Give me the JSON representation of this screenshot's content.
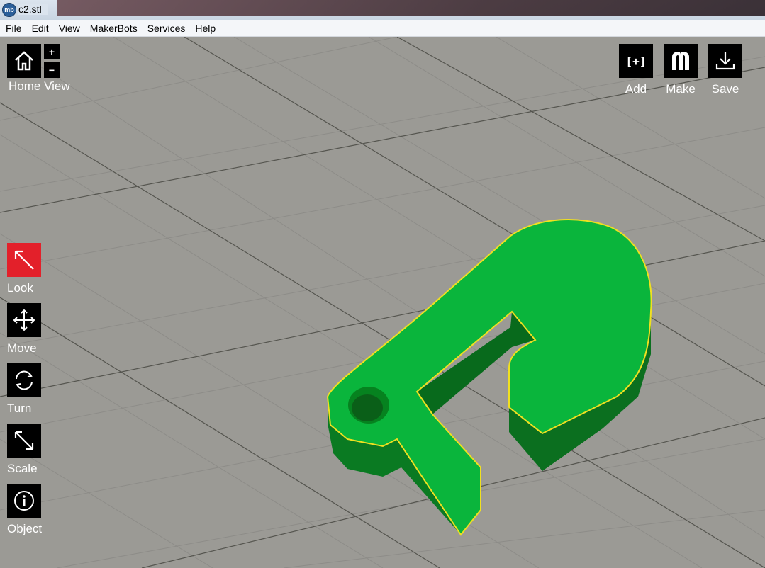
{
  "window": {
    "title": "c2.stl",
    "app_icon": "makerbot-logo-icon"
  },
  "menu": [
    "File",
    "Edit",
    "View",
    "MakerBots",
    "Services",
    "Help"
  ],
  "home": {
    "label": "Home View",
    "zoom_in": "+",
    "zoom_out": "−"
  },
  "actions": {
    "add": "Add",
    "make": "Make",
    "save": "Save",
    "add_glyph": "[+]"
  },
  "tools": {
    "look": "Look",
    "move": "Move",
    "turn": "Turn",
    "scale": "Scale",
    "object": "Object"
  },
  "colors": {
    "active_tool": "#e3202a",
    "model_top": "#0ab53c",
    "model_side": "#0a7a22",
    "model_outline": "#f0e020",
    "grid_background": "#9a9a95"
  }
}
